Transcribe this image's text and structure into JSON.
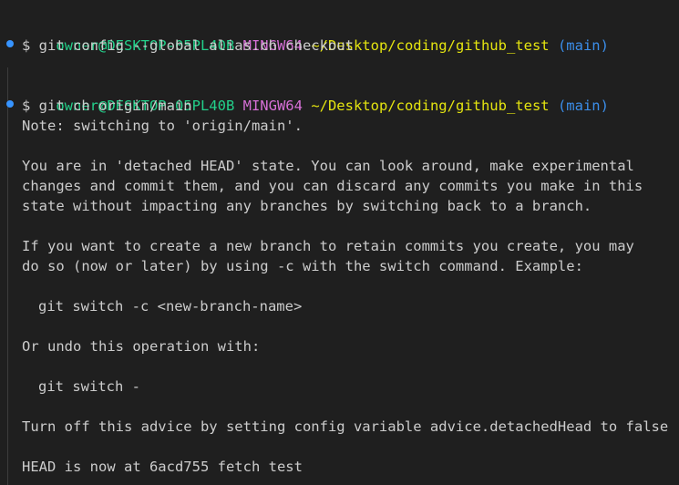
{
  "terminal": {
    "colors": {
      "background": "#1f1f1f",
      "foreground": "#cccccc",
      "user": "#23d18b",
      "mingw": "#d670d6",
      "path": "#e5e510",
      "branch": "#3b8eea",
      "decoration": "#3794ff"
    },
    "prompt1": {
      "user": "owner@DESKTOP-05PL40B",
      "env": "MINGW64",
      "path": "~/Desktop/coding/github_test",
      "branch": "(main)"
    },
    "command1": "$ git config --global alias.ch checkout",
    "prompt2": {
      "user": "owner@DESKTOP-05PL40B",
      "env": "MINGW64",
      "path": "~/Desktop/coding/github_test",
      "branch": "(main)"
    },
    "command2": "$ git ch origin/main",
    "output": {
      "note": "Note: switching to 'origin/main'.",
      "detached_1": "You are in 'detached HEAD' state. You can look around, make experimental",
      "detached_2": "changes and commit them, and you can discard any commits you make in this",
      "detached_3": "state without impacting any branches by switching back to a branch.",
      "create_1": "If you want to create a new branch to retain commits you create, you may",
      "create_2": "do so (now or later) by using -c with the switch command. Example:",
      "example_cmd": "git switch -c <new-branch-name>",
      "undo": "Or undo this operation with:",
      "undo_cmd": "git switch -",
      "advice": "Turn off this advice by setting config variable advice.detachedHead to false",
      "head": "HEAD is now at 6acd755 fetch test"
    }
  }
}
